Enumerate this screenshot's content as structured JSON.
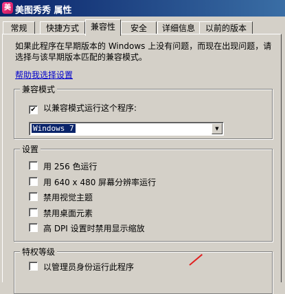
{
  "window": {
    "title": "美图秀秀 属性",
    "app_icon_glyph": "美"
  },
  "tabs": [
    {
      "label": "常规"
    },
    {
      "label": "快捷方式"
    },
    {
      "label": "兼容性"
    },
    {
      "label": "安全"
    },
    {
      "label": "详细信息"
    },
    {
      "label": "以前的版本"
    }
  ],
  "active_tab": "兼容性",
  "description": "如果此程序在早期版本的 Windows 上没有问题，而现在出现问题，请选择与该早期版本匹配的兼容模式。",
  "help_link": "帮助我选择设置",
  "compat_mode": {
    "legend": "兼容模式",
    "checkbox_label": "以兼容模式运行这个程序:",
    "checked": true,
    "selected_os": "Windows 7"
  },
  "settings": {
    "legend": "设置",
    "options": [
      {
        "label": "用 256 色运行",
        "checked": false
      },
      {
        "label": "用 640 x 480 屏幕分辨率运行",
        "checked": false
      },
      {
        "label": "禁用视觉主题",
        "checked": false
      },
      {
        "label": "禁用桌面元素",
        "checked": false
      },
      {
        "label": "高 DPI 设置时禁用显示缩放",
        "checked": false
      }
    ]
  },
  "privilege": {
    "legend": "特权等级",
    "checkbox_label": "以管理员身份运行此程序",
    "checked": false
  },
  "colors": {
    "title_bar": "#0a246a",
    "face": "#d4d0c8",
    "link": "#0000cc",
    "annotation": "#e02020"
  },
  "icons": {
    "checked_glyph": "✔",
    "dropdown_glyph": "▼"
  }
}
